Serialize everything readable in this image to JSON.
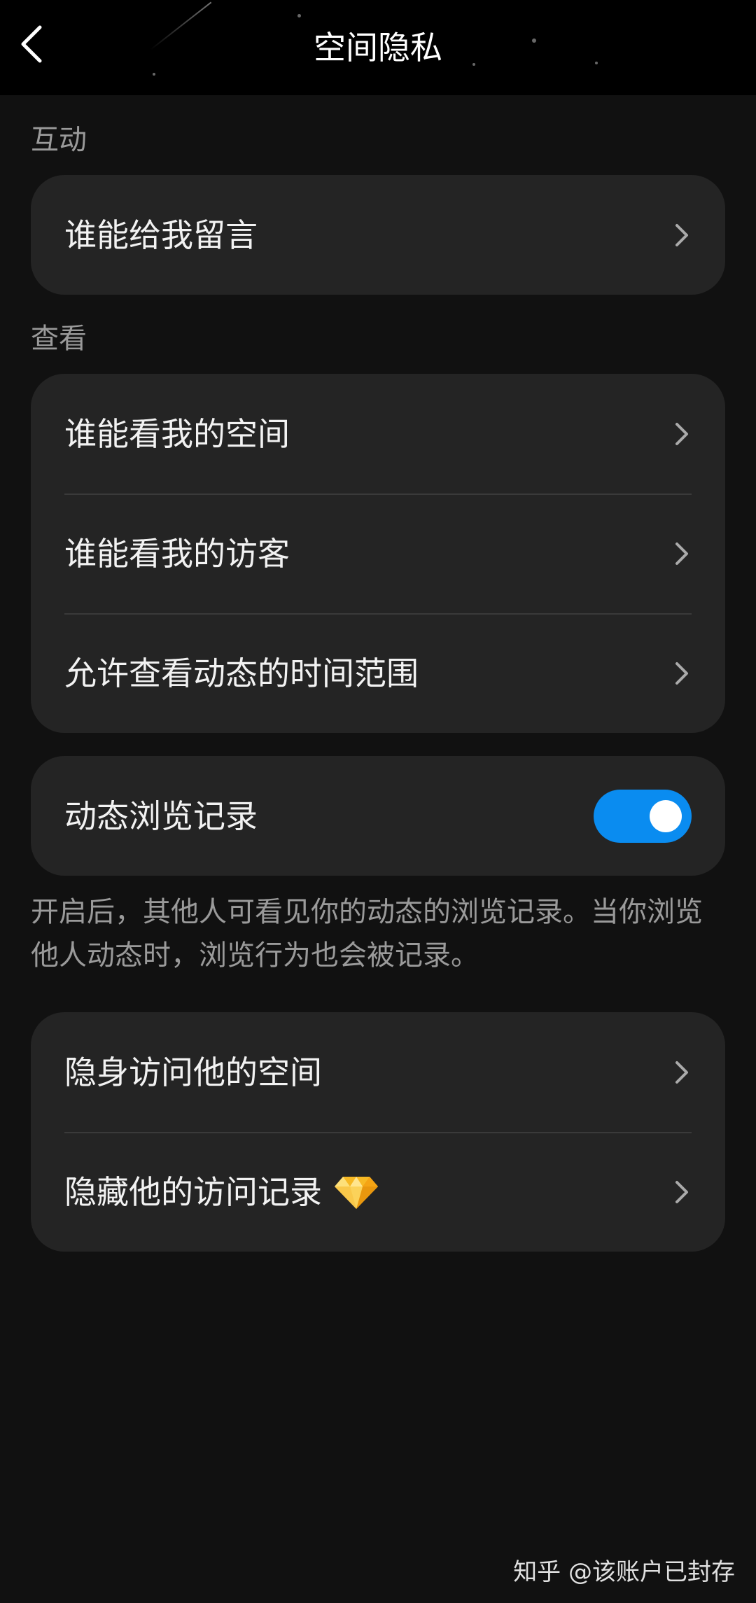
{
  "header": {
    "title": "空间隐私",
    "back_icon": "chevron-left-icon"
  },
  "sections": {
    "interaction": {
      "label": "互动",
      "items": [
        {
          "label": "谁能给我留言"
        }
      ]
    },
    "view": {
      "label": "查看",
      "items": [
        {
          "label": "谁能看我的空间"
        },
        {
          "label": "谁能看我的访客"
        },
        {
          "label": "允许查看动态的时间范围"
        }
      ]
    },
    "browse_record": {
      "label": "动态浏览记录",
      "toggle_on": true,
      "description": "开启后，其他人可看见你的动态的浏览记录。当你浏览他人动态时，浏览行为也会被记录。"
    },
    "stealth": {
      "items": [
        {
          "label": "隐身访问他的空间"
        },
        {
          "label": "隐藏他的访问记录",
          "badge_icon": "diamond-icon"
        }
      ]
    }
  },
  "colors": {
    "background": "#111111",
    "card": "#242424",
    "toggle_on": "#0a8cf0",
    "secondary_text": "#9a9a9a"
  },
  "watermark": "知乎 @该账户已封存"
}
